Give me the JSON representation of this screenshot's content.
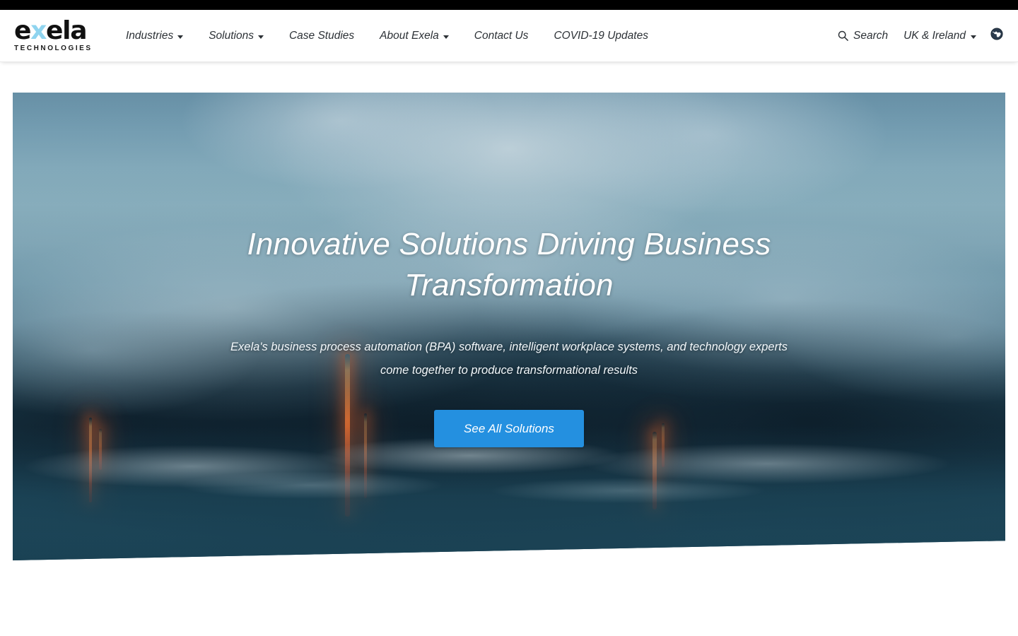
{
  "brand": {
    "logo_word_pre": "e",
    "logo_word_x": "x",
    "logo_word_post": "ela",
    "logo_sub": "TECHNOLOGIES",
    "accent_color": "#8fd4ef",
    "cta_color": "#2490e0"
  },
  "topbar": {
    "color": "#000000"
  },
  "nav": {
    "items": [
      {
        "label": "Industries",
        "has_caret": true
      },
      {
        "label": "Solutions",
        "has_caret": true
      },
      {
        "label": "Case Studies",
        "has_caret": false
      },
      {
        "label": "About Exela",
        "has_caret": true
      },
      {
        "label": "Contact Us",
        "has_caret": false
      },
      {
        "label": "COVID-19 Updates",
        "has_caret": false
      }
    ]
  },
  "utilities": {
    "search_label": "Search",
    "search_icon": "search-icon",
    "region_label": "UK & Ireland",
    "region_has_caret": true,
    "globe_icon": "globe-icon"
  },
  "hero": {
    "title": "Innovative Solutions Driving Business Transformation",
    "subtitle": "Exela's business process automation (BPA) software, intelligent workplace systems, and technology experts come together to produce transformational results",
    "cta_label": "See All Solutions",
    "image_description": "Lava flowing into the ocean with steam and clouds"
  }
}
